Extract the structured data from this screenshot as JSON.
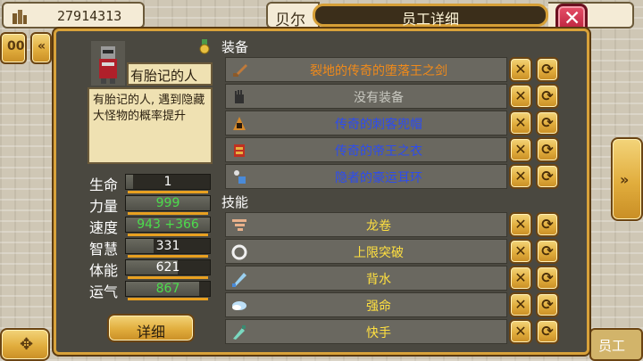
{
  "topbar": {
    "money_value": "27914313",
    "dept_tab_label": "贝尔",
    "title": "员工详细",
    "close_label": "✕"
  },
  "side_buttons": {
    "left_top_1": "00",
    "left_top_2": "«",
    "left_nav": "«",
    "right_nav": "»",
    "right_edge": "»",
    "bottom_left": "✥",
    "bottom_right_tab": "员工"
  },
  "character": {
    "name": "有胎记的人",
    "description": "有胎记的人, 遇到隐藏大怪物的概率提升"
  },
  "stats": [
    {
      "label": "生命",
      "value": "1",
      "color": "#ffffff",
      "level": 0.08
    },
    {
      "label": "力量",
      "value": "999",
      "color": "#4cdc4c",
      "level": 1.0
    },
    {
      "label": "速度",
      "value": "943 +366",
      "color": "#4cdc4c",
      "level": 1.0
    },
    {
      "label": "智慧",
      "value": "331",
      "color": "#ffffff",
      "level": 0.33
    },
    {
      "label": "体能",
      "value": "621",
      "color": "#ffffff",
      "level": 0.62
    },
    {
      "label": "运气",
      "value": "867",
      "color": "#4cdc4c",
      "level": 0.87
    }
  ],
  "detail_button": "详细",
  "equipment_title": "装备",
  "equipment": [
    {
      "name": "裂地的传奇的堕落王之剑",
      "color": "#f08a1a",
      "icon": "sword-icon"
    },
    {
      "name": "没有装备",
      "color": "#c8c8c0",
      "icon": "glove-icon"
    },
    {
      "name": "传奇的刺客兜帽",
      "color": "#2c4cf0",
      "icon": "hood-icon"
    },
    {
      "name": "传奇的帝王之衣",
      "color": "#2c4cf0",
      "icon": "armor-icon"
    },
    {
      "name": "隐者的豪运耳环",
      "color": "#2c4cf0",
      "icon": "earring-icon"
    }
  ],
  "skills_title": "技能",
  "skills": [
    {
      "name": "龙卷",
      "color": "#ffe040",
      "icon": "tornado-icon"
    },
    {
      "name": "上限突破",
      "color": "#ffe040",
      "icon": "ring-icon"
    },
    {
      "name": "背水",
      "color": "#ffe040",
      "icon": "blade-icon"
    },
    {
      "name": "强命",
      "color": "#ffe040",
      "icon": "wing-icon"
    },
    {
      "name": "快手",
      "color": "#ffe040",
      "icon": "dagger-icon"
    }
  ],
  "row_actions": {
    "remove": "✕",
    "swap": "⟳"
  }
}
